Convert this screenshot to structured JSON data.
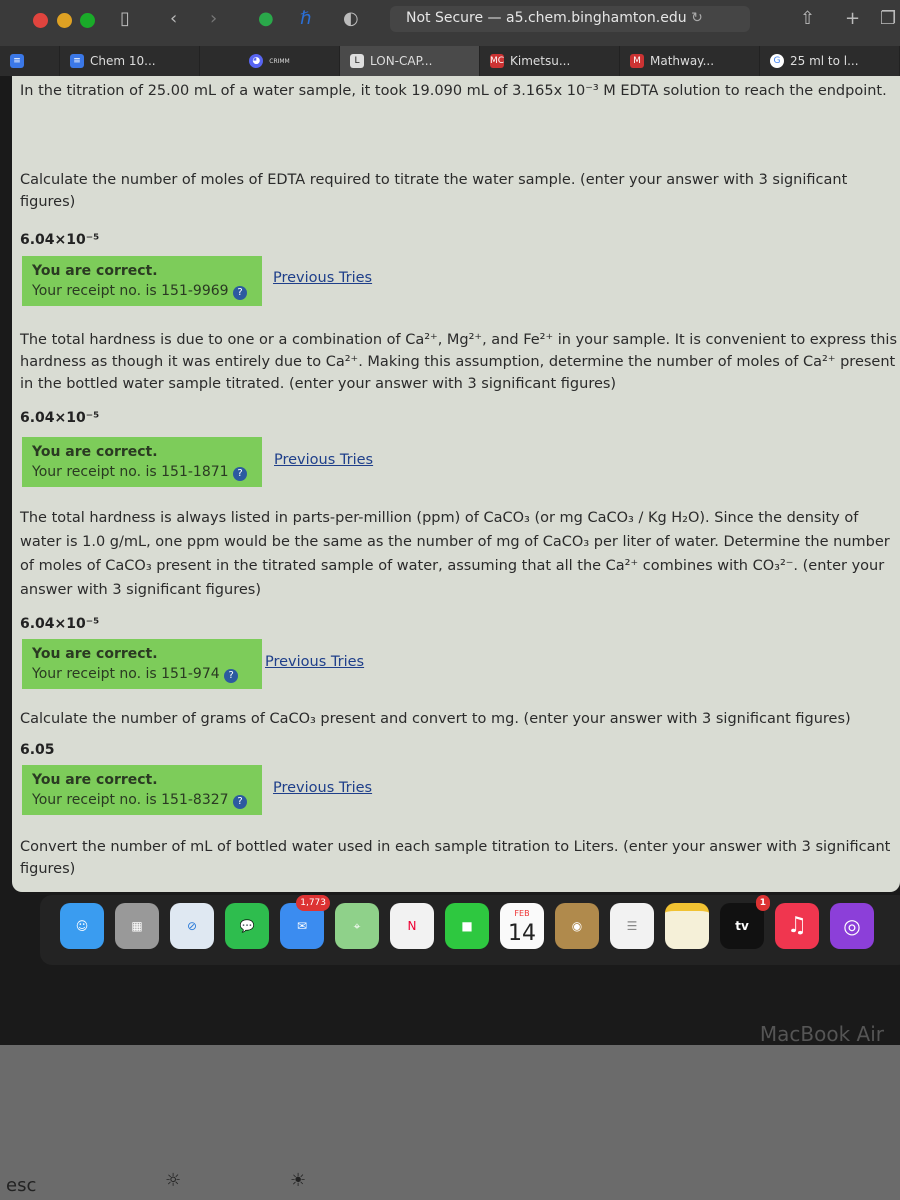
{
  "browser": {
    "url_prefix": "Not Secure —",
    "url": "a5.chem.binghamton.edu",
    "tabs": [
      {
        "label": ""
      },
      {
        "label": "Chem 10..."
      },
      {
        "label": "CRIMM"
      },
      {
        "label": "LON-CAP..."
      },
      {
        "label": "Kimetsu..."
      },
      {
        "label": "Mathway..."
      },
      {
        "label": "25 ml to l..."
      }
    ]
  },
  "problem": {
    "intro": "In the titration of 25.00 mL of a water sample, it took 19.090 mL of 3.165x 10⁻³ M EDTA solution to reach the endpoint.",
    "parts": [
      {
        "question": "Calculate the number of moles of EDTA required to titrate the water sample. (enter your answer with 3 significant figures)",
        "answer": "6.04×10⁻⁵",
        "status": "You are correct.",
        "receipt": "Your receipt no. is 151-9969",
        "prev": "Previous Tries"
      },
      {
        "question": "The total hardness is due to one or a combination of Ca²⁺, Mg²⁺, and Fe²⁺ in your sample. It is convenient to express this hardness as though it was entirely due to Ca²⁺. Making this assumption, determine the number of moles of Ca²⁺ present in the bottled water sample titrated. (enter your answer with 3 significant figures)",
        "answer": "6.04×10⁻⁵",
        "status": "You are correct.",
        "receipt": "Your receipt no. is 151-1871",
        "prev": "Previous Tries"
      },
      {
        "question": "The total hardness is always listed in parts-per-million (ppm) of CaCO₃ (or mg CaCO₃ / Kg H₂O). Since the density of water is 1.0 g/mL, one ppm would be the same as the number of mg of CaCO₃ per liter of water. Determine the number of moles of CaCO₃ present in the titrated sample of water, assuming that all the Ca²⁺ combines with CO₃²⁻. (enter your answer with 3 significant figures)",
        "answer": "6.04×10⁻⁵",
        "status": "You are correct.",
        "receipt": "Your receipt no. is 151-974",
        "prev": "Previous Tries"
      },
      {
        "question": "Calculate the number of grams of CaCO₃ present and convert to mg. (enter your answer with 3 significant figures)",
        "answer": "6.05",
        "status": "You are correct.",
        "receipt": "Your receipt no. is 151-8327",
        "prev": "Previous Tries"
      },
      {
        "question": "Convert the number of mL of bottled water used in each sample titration to Liters. (enter your answer with 3 significant figures)"
      }
    ]
  },
  "dock": {
    "mail_badge": "1,773",
    "calendar_month": "FEB",
    "calendar_day": "14",
    "tv_label": "tv",
    "tv_badge": "1"
  },
  "device": {
    "brand": "MacBook Air",
    "esc": "esc"
  }
}
